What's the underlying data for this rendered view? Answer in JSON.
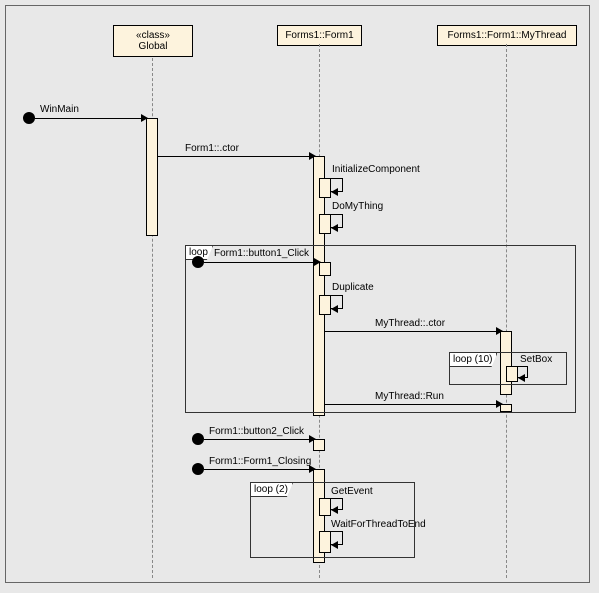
{
  "chart_data": {
    "type": "diagram",
    "diagram_type": "sequence",
    "lifelines": [
      {
        "name": "Global",
        "stereotype": "«class»"
      },
      {
        "name": "Forms1::Form1"
      },
      {
        "name": "Forms1::Form1::MyThread"
      }
    ],
    "messages": [
      {
        "label": "WinMain",
        "from": "external",
        "to": "Global"
      },
      {
        "label": "Form1::.ctor",
        "from": "Global",
        "to": "Forms1::Form1"
      },
      {
        "label": "InitializeComponent",
        "from": "Forms1::Form1",
        "to": "Forms1::Form1",
        "self": true
      },
      {
        "label": "DoMyThing",
        "from": "Forms1::Form1",
        "to": "Forms1::Form1",
        "self": true
      },
      {
        "label": "Form1::button1_Click",
        "from": "external",
        "to": "Forms1::Form1",
        "fragment": "loop"
      },
      {
        "label": "Duplicate",
        "from": "Forms1::Form1",
        "to": "Forms1::Form1",
        "self": true
      },
      {
        "label": "MyThread::.ctor",
        "from": "Forms1::Form1",
        "to": "Forms1::Form1::MyThread"
      },
      {
        "label": "SetBox",
        "from": "Forms1::Form1::MyThread",
        "to": "Forms1::Form1::MyThread",
        "self": true,
        "fragment": "loop (10)"
      },
      {
        "label": "MyThread::Run",
        "from": "Forms1::Form1",
        "to": "Forms1::Form1::MyThread"
      },
      {
        "label": "Form1::button2_Click",
        "from": "external",
        "to": "Forms1::Form1"
      },
      {
        "label": "Form1::Form1_Closing",
        "from": "external",
        "to": "Forms1::Form1"
      },
      {
        "label": "GetEvent",
        "from": "Forms1::Form1",
        "to": "Forms1::Form1",
        "self": true,
        "fragment": "loop (2)"
      },
      {
        "label": "WaitForThreadToEnd",
        "from": "Forms1::Form1",
        "to": "Forms1::Form1",
        "self": true
      }
    ]
  },
  "headers": {
    "global_stereo": "«class»",
    "global_name": "Global",
    "form1": "Forms1::Form1",
    "mythread": "Forms1::Form1::MyThread"
  },
  "labels": {
    "winmain": "WinMain",
    "ctor": "Form1::.ctor",
    "initcomp": "InitializeComponent",
    "domything": "DoMyThing",
    "btn1": "Form1::button1_Click",
    "duplicate": "Duplicate",
    "mythread_ctor": "MyThread::.ctor",
    "setbox": "SetBox",
    "mythread_run": "MyThread::Run",
    "btn2": "Form1::button2_Click",
    "closing": "Form1::Form1_Closing",
    "getevent": "GetEvent",
    "waitthread": "WaitForThreadToEnd",
    "loop": "loop",
    "loop10": "loop (10)",
    "loop2": "loop (2)"
  }
}
